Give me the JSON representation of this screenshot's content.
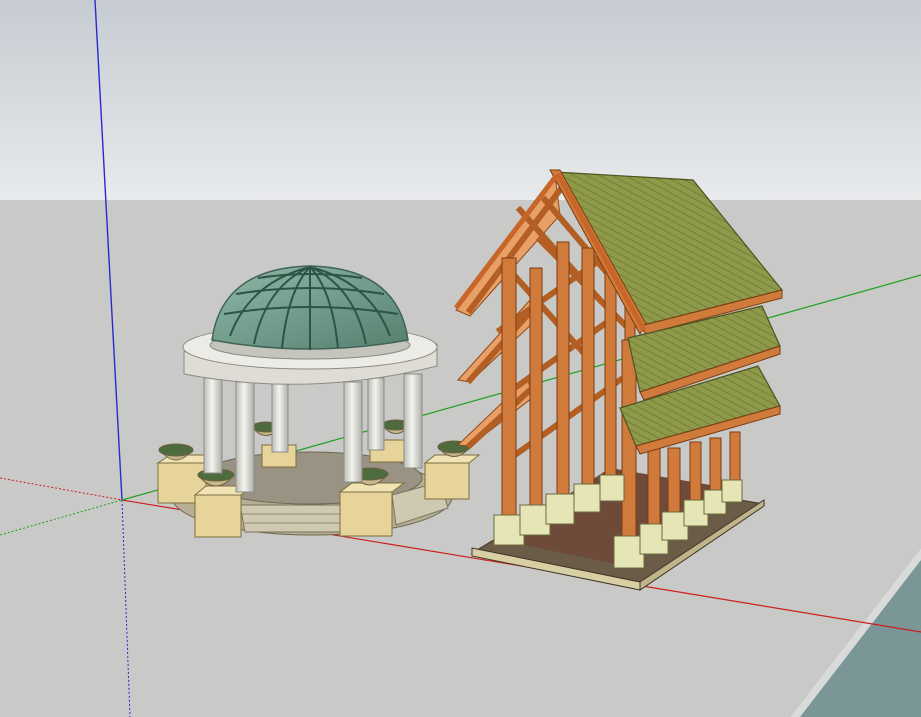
{
  "app": {
    "name": ""
  },
  "viewport": {
    "sky_top_color": "#c6ccd2",
    "sky_bottom_color": "#e8eaec",
    "ground_color": "#c9c9c7",
    "water_color": "#7b9697"
  },
  "axes": {
    "red_axis_color": "#cc1f1f",
    "green_axis_color": "#1fa01f",
    "blue_axis_color": "#2a2ad0"
  },
  "models": [
    {
      "name": "gazebo",
      "dome_color": "#6f9c8c",
      "column_color": "#e7e6e0",
      "plinth_color": "#e7d49a"
    },
    {
      "name": "timber-pavilion",
      "roof_color": "#8e9a4a",
      "timber_color": "#d07b3c",
      "footing_color": "#e6e5b5"
    }
  ]
}
